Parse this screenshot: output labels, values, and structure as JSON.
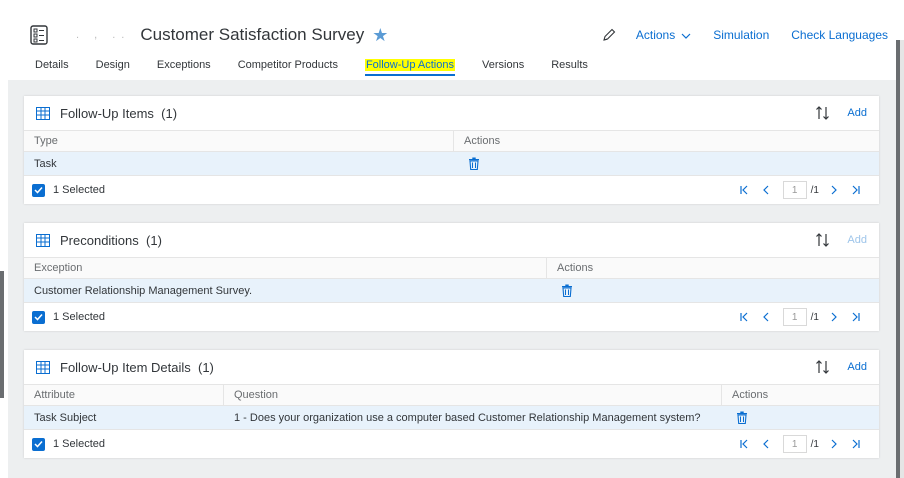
{
  "header": {
    "title": "Customer Satisfaction Survey",
    "dots": ". , ..",
    "actions_label": "Actions",
    "simulation_label": "Simulation",
    "check_languages_label": "Check Languages"
  },
  "tabs": [
    {
      "label": "Details"
    },
    {
      "label": "Design"
    },
    {
      "label": "Exceptions"
    },
    {
      "label": "Competitor Products"
    },
    {
      "label": "Follow-Up Actions",
      "active": true
    },
    {
      "label": "Versions"
    },
    {
      "label": "Results"
    }
  ],
  "followup_items": {
    "title": "Follow-Up Items",
    "count": "(1)",
    "add_label": "Add",
    "columns": [
      "Type",
      "Actions"
    ],
    "rows": [
      {
        "type": "Task"
      }
    ],
    "selected": "1 Selected",
    "page": "1",
    "page_total": "/1"
  },
  "preconditions": {
    "title": "Preconditions",
    "count": "(1)",
    "add_label": "Add",
    "columns": [
      "Exception",
      "Actions"
    ],
    "rows": [
      {
        "exception": "Customer Relationship Management Survey."
      }
    ],
    "selected": "1 Selected",
    "page": "1",
    "page_total": "/1"
  },
  "followup_details": {
    "title": "Follow-Up Item Details",
    "count": "(1)",
    "add_label": "Add",
    "columns": [
      "Attribute",
      "Question",
      "Actions"
    ],
    "rows": [
      {
        "attribute": "Task Subject",
        "question": "1 - Does your organization use a computer based Customer Relationship Management system?"
      }
    ],
    "selected": "1 Selected",
    "page": "1",
    "page_total": "/1"
  },
  "colors": {
    "accent": "#0a6ed1",
    "highlight": "#ffff00",
    "selected_row": "#e8f2fb"
  }
}
